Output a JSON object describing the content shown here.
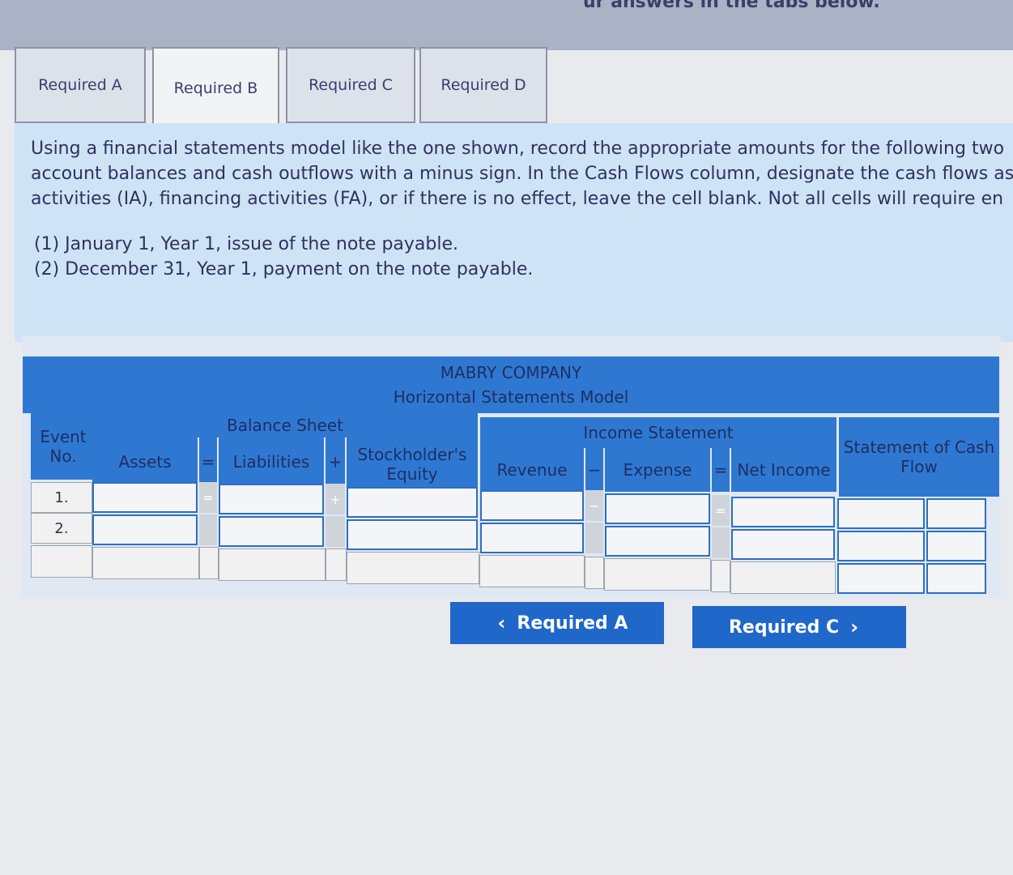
{
  "header": {
    "partial_text": "ur answers in the tabs below."
  },
  "tabs": [
    {
      "label": "Required A",
      "active": false
    },
    {
      "label": "Required B",
      "active": true
    },
    {
      "label": "Required C",
      "active": false
    },
    {
      "label": "Required D",
      "active": false
    }
  ],
  "instructions": {
    "line1": "Using a financial statements model like the one shown, record the appropriate amounts for the following two",
    "line2": "account balances and cash outflows with a minus sign. In the Cash Flows column, designate the cash flows as",
    "line3": "activities (IA), financing activities (FA), or if there is no effect, leave the cell blank. Not all cells will require en"
  },
  "events": {
    "e1": "(1) January 1, Year 1, issue of the note payable.",
    "e2": "(2) December 31, Year 1, payment on the note payable."
  },
  "model": {
    "company": "MABRY COMPANY",
    "title": "Horizontal Statements Model",
    "event_no": "Event No.",
    "balance_sheet": "Balance Sheet",
    "income_statement": "Income Statement",
    "cash_flow": "Statement of Cash Flow",
    "cols": {
      "assets": "Assets",
      "liabilities": "Liabilities",
      "equity": "Stockholder's Equity",
      "revenue": "Revenue",
      "expense": "Expense",
      "net_income": "Net Income"
    },
    "ops": {
      "eq": "=",
      "plus": "+",
      "minus": "−"
    },
    "rows": [
      "1.",
      "2.",
      ""
    ]
  },
  "buttons": {
    "prev": "Required A",
    "next": "Required C"
  }
}
